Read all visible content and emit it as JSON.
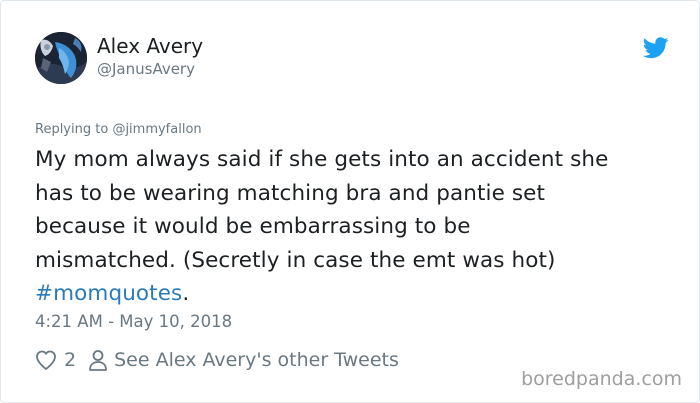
{
  "tweet": {
    "author_name": "Alex Avery",
    "author_handle": "@JanusAvery",
    "reply_prefix": "Replying to",
    "reply_to": "@jimmyfallon",
    "text_lines": [
      "My mom always said if she gets into an accident she",
      "has to be wearing matching bra and pantie set",
      "because it would be embarrassing to be",
      "mismatched. (Secretly in case the emt was hot)"
    ],
    "hashtag": "#momquotes",
    "hashtag_suffix": ".",
    "timestamp": "4:21 AM - May 10, 2018",
    "like_count": "2",
    "other_tweets_link": "See Alex Avery's other Tweets"
  },
  "icons": {
    "twitter_logo": "twitter-bird-icon",
    "like": "heart-icon",
    "profile": "person-icon"
  },
  "colors": {
    "link_blue": "#2b7bb9",
    "twitter_blue": "#1da1f2",
    "muted_text": "#697882",
    "body_text": "#1c2022",
    "watermark": "#9e9e9e"
  },
  "watermark": "boredpanda.com"
}
